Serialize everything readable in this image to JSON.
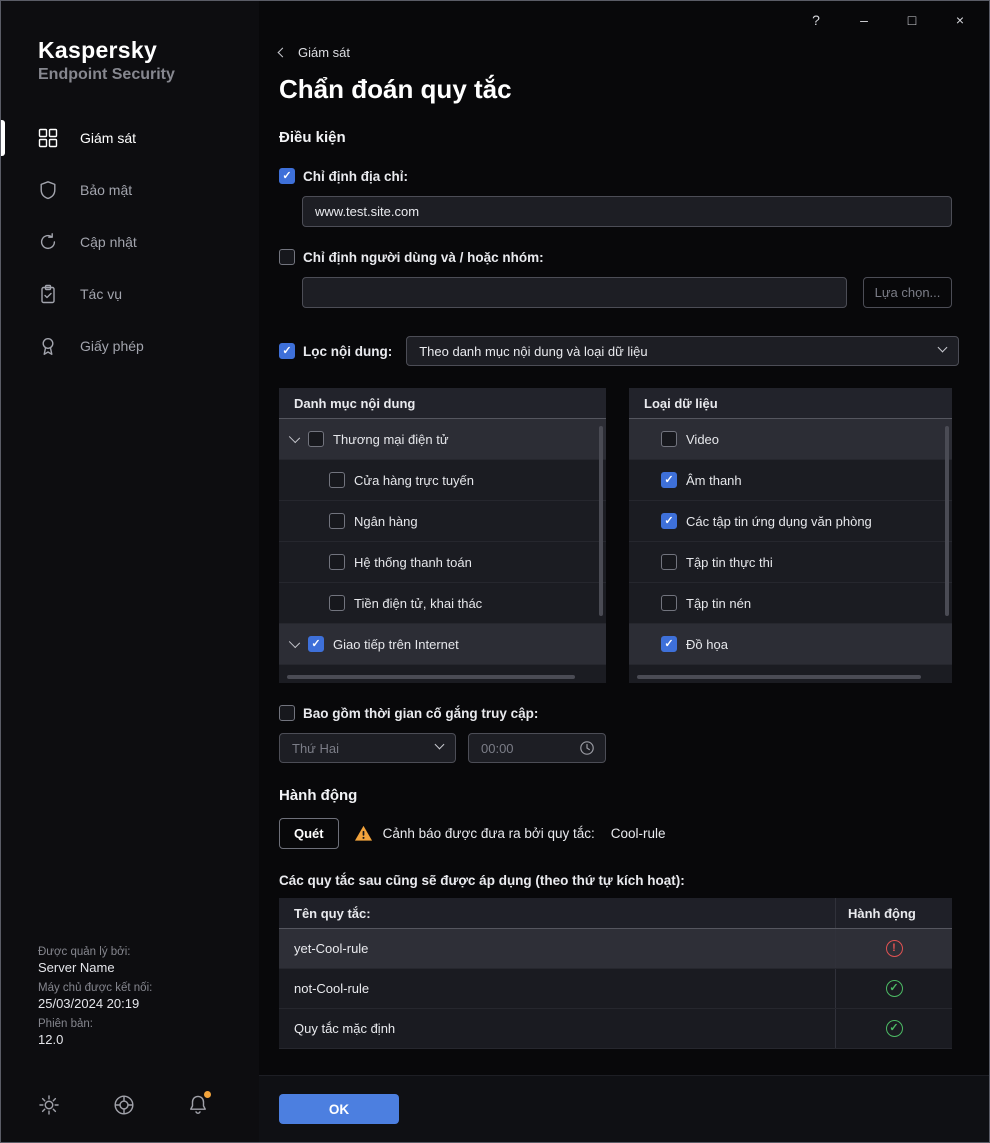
{
  "window": {
    "controls": {
      "help": "?",
      "minimize": "–",
      "maximize": "□",
      "close": "×"
    }
  },
  "sidebar": {
    "brand_title": "Kaspersky",
    "brand_subtitle": "Endpoint Security",
    "items": [
      {
        "label": "Giám sát",
        "icon": "monitoring-icon",
        "active": true
      },
      {
        "label": "Bảo mật",
        "icon": "security-icon",
        "active": false
      },
      {
        "label": "Cập nhật",
        "icon": "update-icon",
        "active": false
      },
      {
        "label": "Tác vụ",
        "icon": "tasks-icon",
        "active": false
      },
      {
        "label": "Giấy phép",
        "icon": "license-icon",
        "active": false
      }
    ],
    "footer": {
      "managed_by_label": "Được quản lý bởi:",
      "managed_by_value": "Server Name",
      "connected_label": "Máy chủ được kết nối:",
      "connected_value": "25/03/2024 20:19",
      "version_label": "Phiên bản:",
      "version_value": "12.0"
    }
  },
  "main": {
    "back_label": "Giám sát",
    "title": "Chẩn đoán quy tắc",
    "sections": {
      "conditions": "Điều kiện",
      "action": "Hành động"
    },
    "address": {
      "label": "Chỉ định địa chỉ:",
      "value": "www.test.site.com",
      "checked": true
    },
    "users": {
      "label": "Chỉ định người dùng và / hoặc nhóm:",
      "value": "",
      "button": "Lựa chọn...",
      "checked": false
    },
    "content_filter": {
      "label": "Lọc nội dung:",
      "selected": "Theo danh mục nội dung và loại dữ liệu",
      "checked": true
    },
    "categories": {
      "header": "Danh mục nội dung",
      "rows": [
        {
          "label": "Thương mại điện tử",
          "checked": false,
          "expanded": true
        },
        {
          "label": "Cửa hàng trực tuyến",
          "checked": false
        },
        {
          "label": "Ngân hàng",
          "checked": false
        },
        {
          "label": "Hệ thống thanh toán",
          "checked": false
        },
        {
          "label": "Tiền điện tử, khai thác",
          "checked": false
        },
        {
          "label": "Giao tiếp trên Internet",
          "checked": true,
          "expanded": true
        }
      ]
    },
    "data_types": {
      "header": "Loại dữ liệu",
      "rows": [
        {
          "label": "Video",
          "checked": false
        },
        {
          "label": "Âm thanh",
          "checked": true
        },
        {
          "label": "Các tập tin ứng dụng văn phòng",
          "checked": true
        },
        {
          "label": "Tập tin thực thi",
          "checked": false
        },
        {
          "label": "Tập tin nén",
          "checked": false
        },
        {
          "label": "Đồ họa",
          "checked": true
        }
      ]
    },
    "time": {
      "label": "Bao gồm thời gian cố gắng truy cập:",
      "day": "Thứ Hai",
      "time": "00:00",
      "checked": false
    },
    "action": {
      "scan_button": "Quét",
      "warning_text": "Cảnh báo được đưa ra bởi quy tắc:",
      "rule_name": "Cool-rule"
    },
    "rules_caption": "Các quy tắc sau cũng sẽ được áp dụng (theo thứ tự kích hoạt):",
    "table": {
      "headers": {
        "name": "Tên quy tắc:",
        "action": "Hành động"
      },
      "rows": [
        {
          "name": "yet-Cool-rule",
          "status": "error",
          "status_icon": "!"
        },
        {
          "name": "not-Cool-rule",
          "status": "ok",
          "status_icon": "✓"
        },
        {
          "name": "Quy tắc mặc định",
          "status": "ok",
          "status_icon": "✓"
        }
      ]
    },
    "ok_button": "OK"
  },
  "icons": {
    "check": "✓"
  },
  "colors": {
    "accent_blue": "#3e70d9",
    "ok_button_blue": "#4c7fe0",
    "warning_orange": "#f2a33c",
    "error_red": "#e05252",
    "success_green": "#4cba64"
  }
}
